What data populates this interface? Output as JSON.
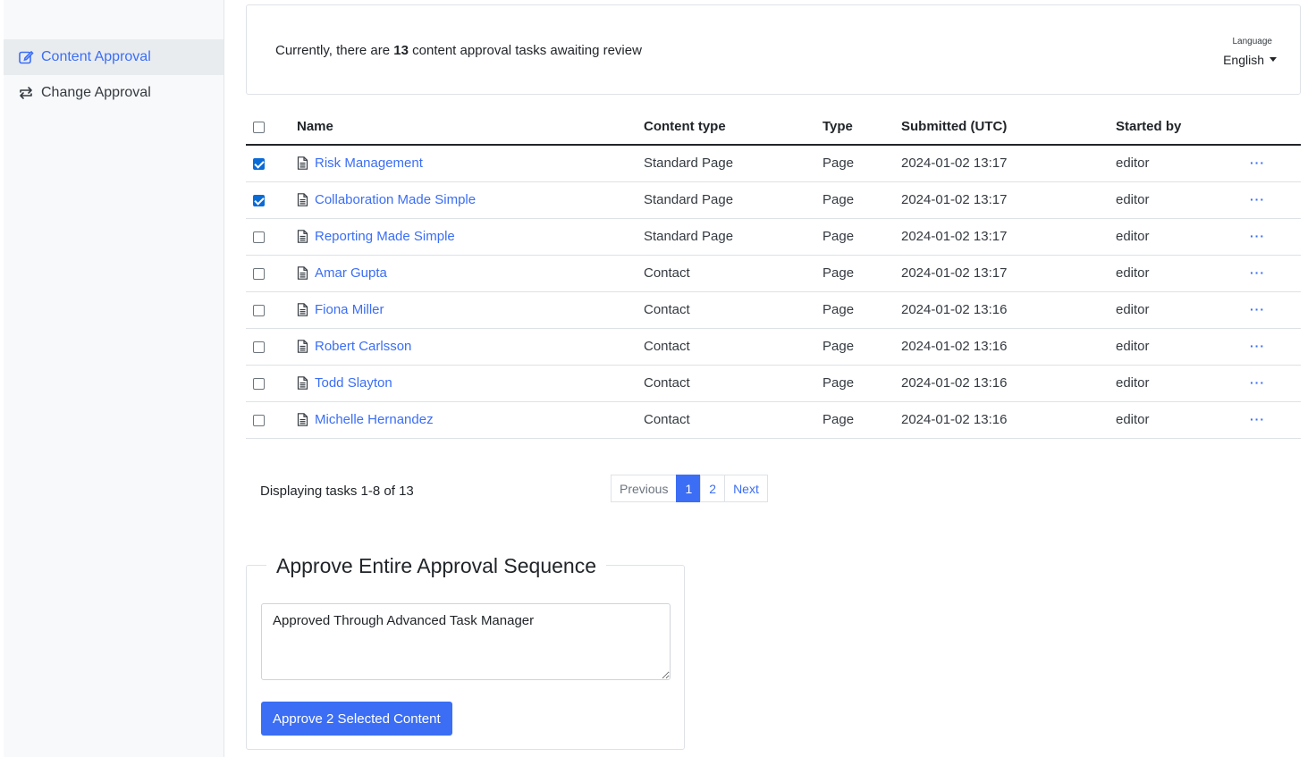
{
  "sidebar": {
    "items": [
      {
        "label": "Content Approval",
        "icon": "edit-icon"
      },
      {
        "label": "Change Approval",
        "icon": "arrows-exchange-icon"
      }
    ]
  },
  "info": {
    "prefix": "Currently, there are ",
    "count": "13",
    "suffix": " content approval tasks awaiting review",
    "language_label": "Language",
    "language_value": "English"
  },
  "table": {
    "headers": {
      "name": "Name",
      "content_type": "Content type",
      "type": "Type",
      "submitted": "Submitted (UTC)",
      "started_by": "Started by"
    },
    "rows": [
      {
        "checked": true,
        "name": "Risk Management",
        "content_type": "Standard Page",
        "type": "Page",
        "submitted": "2024-01-02 13:17",
        "started_by": "editor",
        "actions": "···"
      },
      {
        "checked": true,
        "name": "Collaboration Made Simple",
        "content_type": "Standard Page",
        "type": "Page",
        "submitted": "2024-01-02 13:17",
        "started_by": "editor",
        "actions": "···"
      },
      {
        "checked": false,
        "name": "Reporting Made Simple",
        "content_type": "Standard Page",
        "type": "Page",
        "submitted": "2024-01-02 13:17",
        "started_by": "editor",
        "actions": "···"
      },
      {
        "checked": false,
        "name": "Amar Gupta",
        "content_type": "Contact",
        "type": "Page",
        "submitted": "2024-01-02 13:17",
        "started_by": "editor",
        "actions": "···"
      },
      {
        "checked": false,
        "name": "Fiona Miller",
        "content_type": "Contact",
        "type": "Page",
        "submitted": "2024-01-02 13:16",
        "started_by": "editor",
        "actions": "···"
      },
      {
        "checked": false,
        "name": "Robert Carlsson",
        "content_type": "Contact",
        "type": "Page",
        "submitted": "2024-01-02 13:16",
        "started_by": "editor",
        "actions": "···"
      },
      {
        "checked": false,
        "name": "Todd Slayton",
        "content_type": "Contact",
        "type": "Page",
        "submitted": "2024-01-02 13:16",
        "started_by": "editor",
        "actions": "···"
      },
      {
        "checked": false,
        "name": "Michelle Hernandez",
        "content_type": "Contact",
        "type": "Page",
        "submitted": "2024-01-02 13:16",
        "started_by": "editor",
        "actions": "···"
      }
    ]
  },
  "footer": {
    "display_text": "Displaying tasks 1-8 of 13",
    "pagination": {
      "previous": "Previous",
      "pages": [
        "1",
        "2"
      ],
      "active_page": "1",
      "next": "Next"
    }
  },
  "approve": {
    "legend": "Approve Entire Approval Sequence",
    "note": "Approved Through Advanced Task Manager",
    "button": "Approve 2 Selected Content"
  },
  "colors": {
    "accent": "#3b6ef5",
    "checkbox": "#0b6bd6"
  }
}
